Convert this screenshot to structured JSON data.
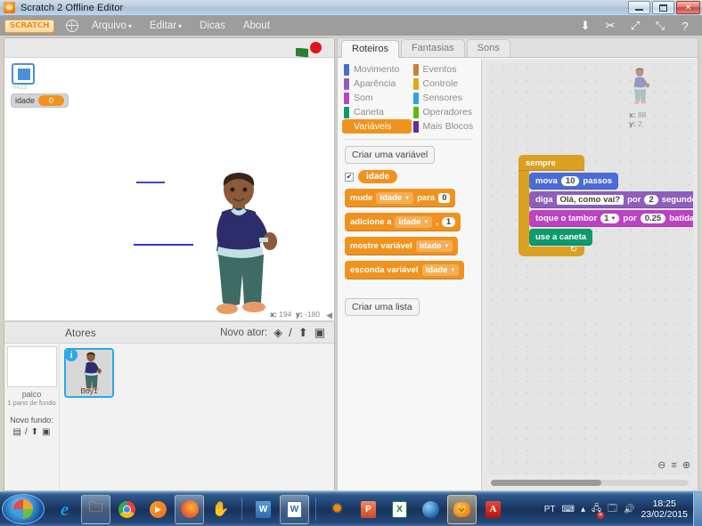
{
  "window": {
    "title": "Scratch 2 Offline Editor",
    "icon": "scratch-cat-icon",
    "controls": {
      "minimize": "minimize",
      "restore": "restore",
      "close": "close"
    }
  },
  "menubar": {
    "logo": "SCRATCH",
    "globe_icon": "globe-icon",
    "items": [
      {
        "label": "Arquivo",
        "caret": "▾"
      },
      {
        "label": "Editar",
        "caret": "▾"
      },
      {
        "label": "Dicas",
        "caret": ""
      },
      {
        "label": "About",
        "caret": ""
      }
    ],
    "tools": [
      {
        "name": "stamp-icon",
        "glyph": "⬇"
      },
      {
        "name": "scissors-icon",
        "glyph": "✂"
      },
      {
        "name": "grow-icon",
        "glyph": "⤢"
      },
      {
        "name": "shrink-icon",
        "glyph": "⤡"
      },
      {
        "name": "help-icon",
        "glyph": "?"
      }
    ]
  },
  "stage": {
    "green_flag": "green-flag",
    "stop_button": "stop-button",
    "version_label": "v423",
    "watcher": {
      "name": "idade",
      "value": "0"
    },
    "mouse": {
      "x_label": "x:",
      "x": "194",
      "y_label": "y:",
      "y": "-180"
    }
  },
  "sprite_pane": {
    "title": "Atores",
    "new_sprite_label": "Novo ator:",
    "new_sprite_icons": [
      {
        "name": "sprite-library-icon",
        "glyph": "◈"
      },
      {
        "name": "paint-new-sprite-icon",
        "glyph": "/"
      },
      {
        "name": "upload-sprite-icon",
        "glyph": "⬆"
      },
      {
        "name": "camera-sprite-icon",
        "glyph": "▣"
      }
    ],
    "stage_item": {
      "label": "palco",
      "sublabel": "1 pano de fundo",
      "new_backdrop_label": "Novo fundo:",
      "new_backdrop_icons": [
        {
          "name": "backdrop-library-icon",
          "glyph": "▤"
        },
        {
          "name": "paint-backdrop-icon",
          "glyph": "/"
        },
        {
          "name": "upload-backdrop-icon",
          "glyph": "⬆"
        },
        {
          "name": "camera-backdrop-icon",
          "glyph": "▣"
        }
      ]
    },
    "sprites": [
      {
        "name": "Boy1",
        "info_badge": "i",
        "selected": true
      }
    ]
  },
  "editor": {
    "tabs": [
      {
        "label": "Roteiros",
        "active": true
      },
      {
        "label": "Fantasias",
        "active": false
      },
      {
        "label": "Sons",
        "active": false
      }
    ],
    "categories_left": [
      {
        "label": "Movimento",
        "color": "#4a6cd4",
        "selected": false
      },
      {
        "label": "Aparência",
        "color": "#8e5ebd",
        "selected": false
      },
      {
        "label": "Som",
        "color": "#bb42c3",
        "selected": false
      },
      {
        "label": "Caneta",
        "color": "#0e9a6c",
        "selected": false
      },
      {
        "label": "Variáveis",
        "color": "#f0931e",
        "selected": true
      }
    ],
    "categories_right": [
      {
        "label": "Eventos",
        "color": "#c88330",
        "selected": false
      },
      {
        "label": "Controle",
        "color": "#e1a91a",
        "selected": false
      },
      {
        "label": "Sensores",
        "color": "#2ca5e2",
        "selected": false
      },
      {
        "label": "Operadores",
        "color": "#5cb712",
        "selected": false
      },
      {
        "label": "Mais Blocos",
        "color": "#632d99",
        "selected": false
      }
    ],
    "make_variable_button": "Criar uma variável",
    "make_list_button": "Criar uma lista",
    "variable": {
      "checkbox": "✔",
      "name": "idade"
    },
    "palette_blocks": [
      {
        "parts": [
          {
            "t": "label",
            "v": "mude"
          },
          {
            "t": "drop",
            "v": "idade"
          },
          {
            "t": "label",
            "v": "para"
          },
          {
            "t": "inp",
            "v": "0"
          }
        ]
      },
      {
        "parts": [
          {
            "t": "label",
            "v": "adicione a"
          },
          {
            "t": "drop",
            "v": "idade"
          },
          {
            "t": "label",
            "v": ","
          },
          {
            "t": "rinp",
            "v": "1"
          }
        ]
      },
      {
        "parts": [
          {
            "t": "label",
            "v": "mostre variável"
          },
          {
            "t": "drop",
            "v": "idade"
          }
        ]
      },
      {
        "parts": [
          {
            "t": "label",
            "v": "esconda variável"
          },
          {
            "t": "drop",
            "v": "idade"
          }
        ]
      }
    ]
  },
  "scripts_area": {
    "sprite_info": {
      "x_label": "x:",
      "x": "88",
      "y_label": "y:",
      "y": "2"
    },
    "script": {
      "c_block_label": "sempre",
      "blocks": [
        {
          "cat": "motion",
          "parts": [
            {
              "t": "label",
              "v": "mova"
            },
            {
              "t": "ov",
              "v": "10"
            },
            {
              "t": "label",
              "v": "passos"
            }
          ]
        },
        {
          "cat": "looks",
          "parts": [
            {
              "t": "label",
              "v": "diga"
            },
            {
              "t": "tx",
              "v": "Olá, como vai?"
            },
            {
              "t": "label",
              "v": "por"
            },
            {
              "t": "ov",
              "v": "2"
            },
            {
              "t": "label",
              "v": "segundos"
            }
          ]
        },
        {
          "cat": "sound",
          "parts": [
            {
              "t": "label",
              "v": "toque o tambor"
            },
            {
              "t": "dd",
              "v": "1"
            },
            {
              "t": "label",
              "v": "por"
            },
            {
              "t": "ov",
              "v": "0.25"
            },
            {
              "t": "label",
              "v": "batidas"
            }
          ]
        },
        {
          "cat": "pen",
          "parts": [
            {
              "t": "label",
              "v": "use a caneta"
            }
          ]
        }
      ]
    },
    "zoom_controls": [
      {
        "name": "zoom-out-button",
        "glyph": "⊖"
      },
      {
        "name": "zoom-reset-button",
        "glyph": "≡"
      },
      {
        "name": "zoom-in-button",
        "glyph": "⊕"
      }
    ]
  },
  "taskbar": {
    "start_button": "start-button",
    "items": [
      {
        "name": "internet-explorer-icon",
        "glyph": "e",
        "state": ""
      },
      {
        "name": "file-explorer-icon",
        "glyph": "🗂",
        "state": "open"
      },
      {
        "name": "google-chrome-icon",
        "glyph": "◉",
        "state": ""
      },
      {
        "name": "media-player-icon",
        "glyph": "▶",
        "state": ""
      },
      {
        "name": "firefox-icon",
        "glyph": "◍",
        "state": "open"
      },
      {
        "name": "paint-glove-icon",
        "glyph": "✋",
        "state": ""
      },
      {
        "name": "word-doc-icon",
        "glyph": "W",
        "state": ""
      },
      {
        "name": "word-icon",
        "glyph": "W",
        "state": "open"
      },
      {
        "name": "avast-icon",
        "glyph": "✺",
        "state": ""
      },
      {
        "name": "powerpoint-icon",
        "glyph": "P",
        "state": ""
      },
      {
        "name": "excel-icon",
        "glyph": "X",
        "state": ""
      },
      {
        "name": "google-earth-icon",
        "glyph": "◯",
        "state": ""
      },
      {
        "name": "scratch-icon",
        "glyph": "🐱",
        "state": "active"
      },
      {
        "name": "adobe-reader-icon",
        "glyph": "A",
        "state": ""
      }
    ],
    "tray": {
      "language": "PT",
      "keyboard_icon": "keyboard-icon",
      "show_hidden_icon": "▴",
      "network_icon": "network-error-icon",
      "action_center_icon": "action-center-icon",
      "volume_icon": "volume-icon",
      "time": "18:25",
      "date": "23/02/2015"
    }
  }
}
